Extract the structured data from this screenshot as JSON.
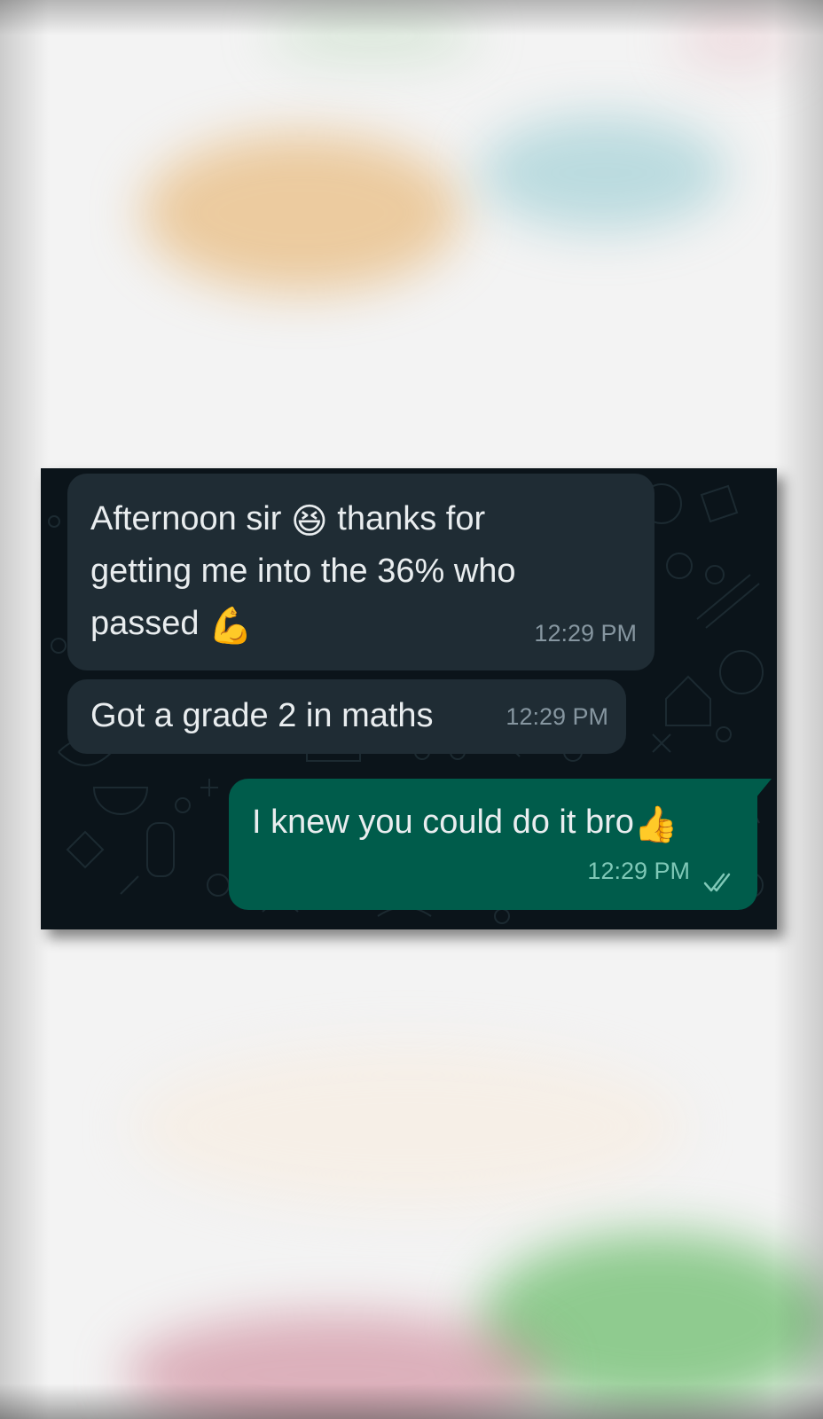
{
  "conversation": {
    "messages": [
      {
        "direction": "incoming",
        "text_parts": [
          "Afternoon sir ",
          "😆",
          " thanks for\ngetting me into the 36% who\npassed ",
          "💪"
        ],
        "time": "12:29 PM"
      },
      {
        "direction": "incoming",
        "text_parts": [
          "Got a grade 2 in maths"
        ],
        "time": "12:29 PM"
      },
      {
        "direction": "outgoing",
        "text_parts": [
          "I knew you could do it bro",
          "👍"
        ],
        "time": "12:29 PM",
        "status_icon": "double-check-icon"
      }
    ]
  },
  "colors": {
    "chat_background": "#0b141a",
    "incoming_bubble": "#1f2c34",
    "outgoing_bubble": "#005c4b",
    "message_text": "#e9edef",
    "timestamp_incoming": "#8696a0",
    "timestamp_outgoing": "#7fc8b7"
  }
}
